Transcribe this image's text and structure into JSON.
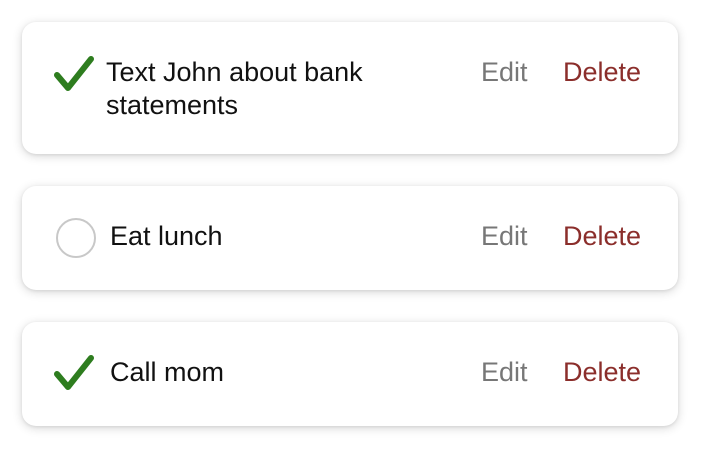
{
  "colors": {
    "check_green": "#2e7d1f",
    "delete_red": "#8b2e2b",
    "edit_gray": "#777777",
    "circle_border": "#c8c8c8"
  },
  "todos": [
    {
      "text": "Text John about bank statements",
      "status_icon": "checkmark-icon",
      "completed": true,
      "edit_label": "Edit",
      "delete_label": "Delete"
    },
    {
      "text": "Eat lunch",
      "status_icon": "empty-circle-icon",
      "completed": false,
      "edit_label": "Edit",
      "delete_label": "Delete"
    },
    {
      "text": "Call mom",
      "status_icon": "checkmark-icon",
      "completed": true,
      "edit_label": "Edit",
      "delete_label": "Delete"
    }
  ]
}
